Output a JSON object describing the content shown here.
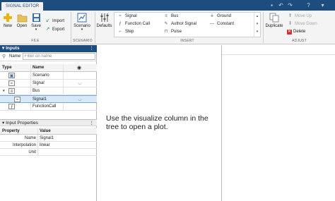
{
  "app_tab": "SIGNAL EDITOR",
  "ribbon": {
    "file": {
      "section_label": "FILE",
      "new": "New",
      "open": "Open",
      "save": "Save",
      "import": "Import",
      "export": "Export"
    },
    "scenario": {
      "section_label": "SCENARIO",
      "scenario": "Scenario"
    },
    "defaults": "Defaults",
    "insert": {
      "section_label": "INSERT",
      "signal": "Signal",
      "function_call": "Function Call",
      "step": "Step",
      "bus": "Bus",
      "author_signal": "Author Signal",
      "pulse": "Pulse",
      "ground": "Ground",
      "constant": "Constant"
    },
    "adjust": {
      "section_label": "ADJUST",
      "duplicate": "Duplicate",
      "move_up": "Move Up",
      "move_down": "Move Down",
      "delete": "Delete"
    }
  },
  "inputs_panel": {
    "title": "Inputs",
    "filter_label": "Name",
    "filter_placeholder": "Filter on name",
    "columns": {
      "type": "Type",
      "name": "Name"
    },
    "rows": [
      {
        "name": "Scenario",
        "type_icon": "scenario-icon"
      },
      {
        "name": "Signal",
        "type_icon": "signal-icon"
      },
      {
        "name": "Bus",
        "type_icon": "bus-icon"
      },
      {
        "name": "Signal1",
        "type_icon": "signal-icon",
        "selected": true
      },
      {
        "name": "FunctionCall",
        "type_icon": "function-call-icon"
      }
    ]
  },
  "properties_panel": {
    "title": "Input Properties",
    "columns": {
      "property": "Property",
      "value": "Value"
    },
    "rows": [
      {
        "property": "Name",
        "value": "Signal1"
      },
      {
        "property": "Interpolation",
        "value": "linear"
      },
      {
        "property": "Unit",
        "value": ""
      }
    ]
  },
  "hint": "Use the visualize column in the tree to open a plot.",
  "colors": {
    "accent": "#1d4c7e",
    "selection": "#d7e8f8",
    "add_green": "#f0b400",
    "delete_red": "#d03030"
  }
}
